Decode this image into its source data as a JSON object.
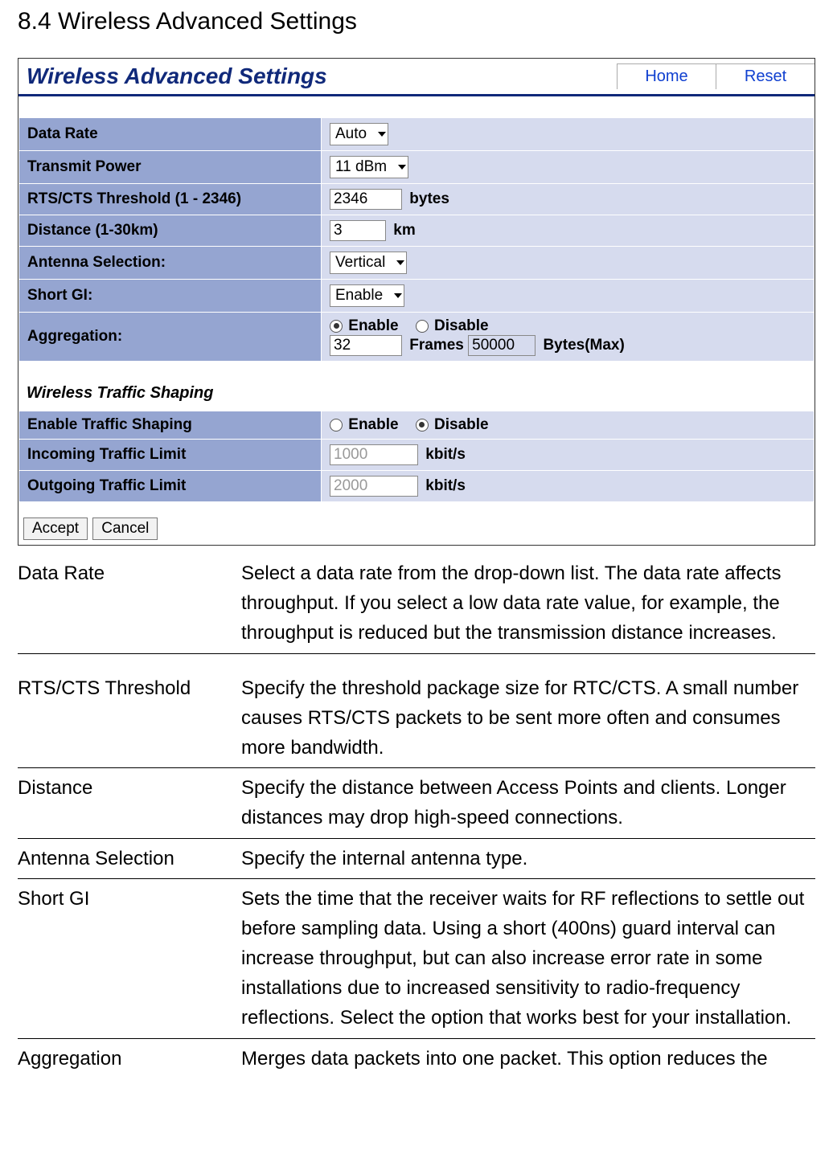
{
  "page_heading": "8.4 Wireless Advanced Settings",
  "panel": {
    "title": "Wireless Advanced Settings",
    "home": "Home",
    "reset": "Reset"
  },
  "fields": {
    "data_rate": {
      "label": "Data Rate",
      "value": "Auto"
    },
    "tx_power": {
      "label": "Transmit Power",
      "value": "11 dBm"
    },
    "rts": {
      "label": "RTS/CTS Threshold (1 - 2346)",
      "value": "2346",
      "unit": "bytes"
    },
    "distance": {
      "label": "Distance (1-30km)",
      "value": "3",
      "unit": "km"
    },
    "antenna": {
      "label": "Antenna Selection:",
      "value": "Vertical"
    },
    "short_gi": {
      "label": "Short GI:",
      "value": "Enable"
    },
    "aggregation": {
      "label": "Aggregation:",
      "enable": "Enable",
      "disable": "Disable",
      "frames_value": "32",
      "frames_label": "Frames",
      "bytes_value": "50000",
      "bytes_label": "Bytes(Max)"
    }
  },
  "traffic_heading": "Wireless Traffic Shaping",
  "traffic": {
    "enable_label": "Enable Traffic Shaping",
    "enable": "Enable",
    "disable": "Disable",
    "incoming_label": "Incoming Traffic Limit",
    "incoming_value": "1000",
    "incoming_unit": "kbit/s",
    "outgoing_label": "Outgoing Traffic Limit",
    "outgoing_value": "2000",
    "outgoing_unit": "kbit/s"
  },
  "buttons": {
    "accept": "Accept",
    "cancel": "Cancel"
  },
  "docs": [
    {
      "term": "Data Rate",
      "desc": "Select a data rate from the drop-down list. The data rate affects throughput. If you select a low data rate value, for example, the throughput is reduced but the transmission distance increases."
    },
    {
      "term": "RTS/CTS Threshold",
      "desc": "Specify the threshold package size for RTC/CTS. A small number causes RTS/CTS packets to be sent more often and consumes more bandwidth."
    },
    {
      "term": "Distance",
      "desc": "Specify the distance between Access Points and clients. Longer distances may drop high-speed connections."
    },
    {
      "term": "Antenna Selection",
      "desc": "Specify the internal antenna type."
    },
    {
      "term": "Short GI",
      "desc": "Sets the time that the receiver waits for RF reflections to settle out before sampling data. Using a short (400ns) guard interval can increase throughput, but can also increase error rate in some installations due to increased sensitivity to radio-frequency reflections. Select the option that works best for your installation."
    },
    {
      "term": "Aggregation",
      "desc": "Merges data packets into one packet. This option reduces the"
    }
  ]
}
